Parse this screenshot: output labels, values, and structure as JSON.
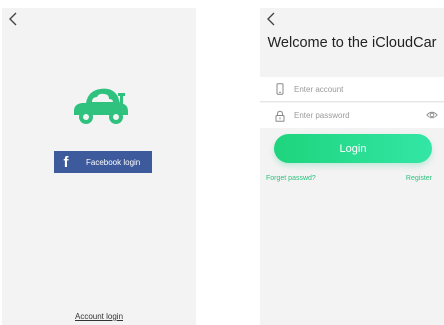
{
  "screen_a": {
    "facebook_button": {
      "icon_glyph": "f",
      "label": "Facebook login",
      "color": "#3d5a9c"
    },
    "account_login_link": "Account login",
    "brand_color": "#2ec27e"
  },
  "screen_b": {
    "title": "Welcome to the iCloudCar",
    "account_field": {
      "placeholder": "Enter account",
      "value": ""
    },
    "password_field": {
      "placeholder": "Enter password",
      "value": ""
    },
    "login_button": "Login",
    "forget_link": "Forget passwd?",
    "register_link": "Register",
    "accent_gradient": [
      "#1ed47c",
      "#34e6a6"
    ]
  },
  "icons": [
    "back-arrow-icon",
    "car-logo-icon",
    "facebook-icon",
    "phone-icon",
    "lock-icon",
    "eye-icon"
  ]
}
